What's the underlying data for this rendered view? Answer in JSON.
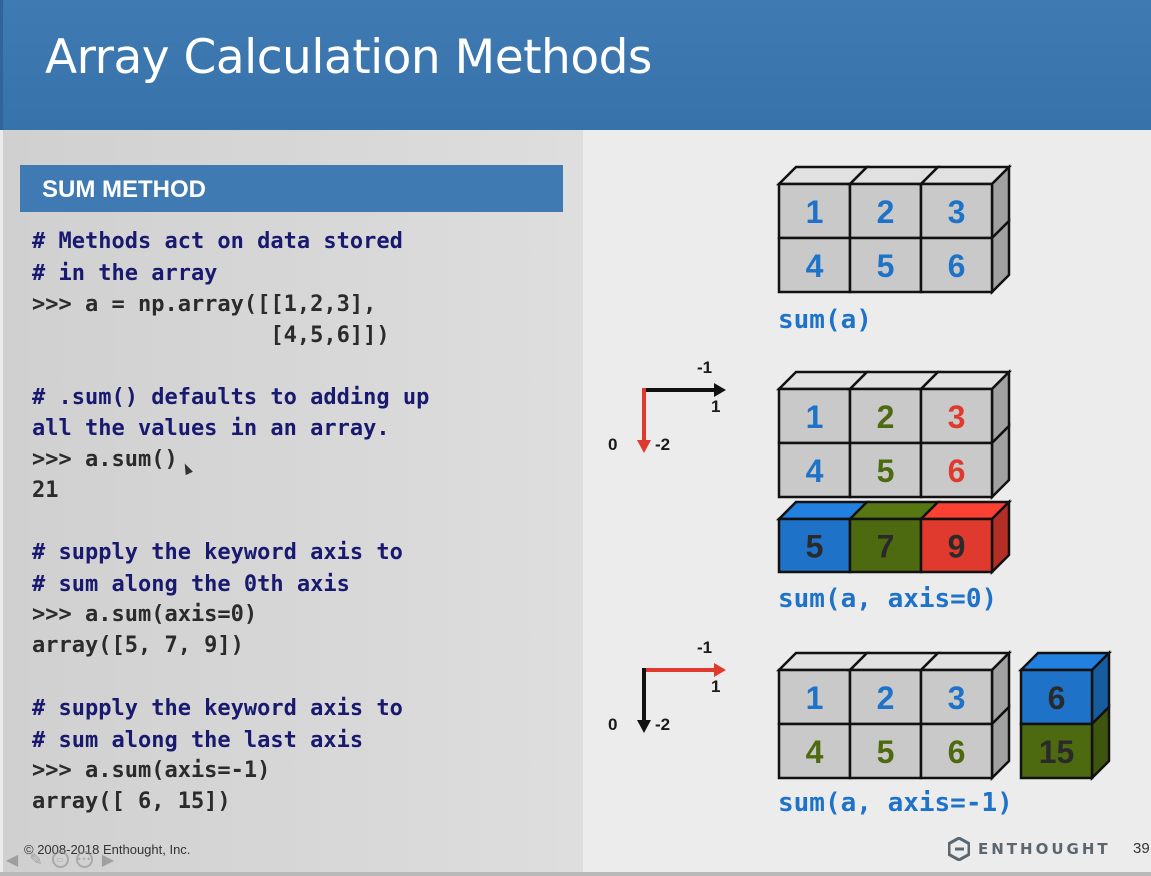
{
  "slide": {
    "title": "Array Calculation Methods",
    "section": "SUM METHOD",
    "code": [
      {
        "text": "# Methods act on data stored",
        "kind": "comment"
      },
      {
        "text": "# in the array",
        "kind": "comment"
      },
      {
        "text": ">>> a = np.array([[1,2,3],",
        "kind": "code"
      },
      {
        "text": "                  [4,5,6]])",
        "kind": "code"
      },
      {
        "text": "# .sum() defaults to adding up",
        "kind": "comment"
      },
      {
        "text": "all the values in an array.",
        "kind": "comment"
      },
      {
        "text": ">>> a.sum()",
        "kind": "code"
      },
      {
        "text": "21",
        "kind": "code"
      },
      {
        "text": "# supply the keyword axis to",
        "kind": "comment"
      },
      {
        "text": "# sum along the 0th axis",
        "kind": "comment"
      },
      {
        "text": ">>> a.sum(axis=0)",
        "kind": "code"
      },
      {
        "text": "array([5, 7, 9])",
        "kind": "code"
      },
      {
        "text": "# supply the keyword axis to",
        "kind": "comment"
      },
      {
        "text": "# sum along the last axis",
        "kind": "comment"
      },
      {
        "text": ">>> a.sum(axis=-1)",
        "kind": "code"
      },
      {
        "text": "array([ 6, 15])",
        "kind": "code"
      }
    ],
    "footer": "© 2008-2018 Enthought, Inc.",
    "logo_text": "ENTHOUGHT",
    "page_number": "39"
  },
  "figures": {
    "sum_all": {
      "label": "sum(a)",
      "cells": [
        [
          "1",
          "2",
          "3"
        ],
        [
          "4",
          "5",
          "6"
        ]
      ]
    },
    "sum_axis0": {
      "label": "sum(a, axis=0)",
      "cells": [
        [
          "1",
          "2",
          "3"
        ],
        [
          "4",
          "5",
          "6"
        ]
      ],
      "result": [
        "5",
        "7",
        "9"
      ]
    },
    "sum_axis_neg1": {
      "label": "sum(a, axis=-1)",
      "cells": [
        [
          "1",
          "2",
          "3"
        ],
        [
          "4",
          "5",
          "6"
        ]
      ],
      "result": [
        "6",
        "15"
      ]
    },
    "axis_diagram": {
      "horizontal_labels": [
        "-1",
        "1"
      ],
      "vertical_labels": [
        "0",
        "-2"
      ]
    }
  },
  "colors": {
    "header": "#3f7ab2",
    "comment": "#191970",
    "code": "#2b2b2b",
    "label": "#1e73c8",
    "blue": "#1e73c8",
    "olive": "#4e6a10",
    "red": "#e03a2e",
    "cell_face": "#c9c9c9"
  },
  "toolbar": {
    "icons": [
      "arrow-left-icon",
      "pen-icon",
      "slides-icon",
      "more-icon",
      "arrow-right-icon"
    ]
  }
}
